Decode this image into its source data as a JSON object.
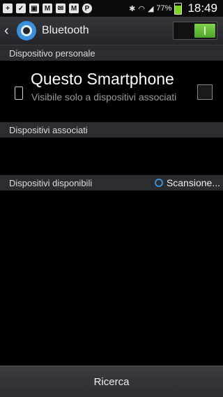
{
  "statusbar": {
    "left_icons": [
      "plus-icon",
      "check-icon",
      "image-icon",
      "gmail-icon",
      "email-icon",
      "gmail-icon",
      "parking-icon"
    ],
    "right_icons": [
      "bluetooth-icon",
      "wifi-icon",
      "signal-icon"
    ],
    "battery": "77%",
    "battery_level": 0.77,
    "time": "18:49"
  },
  "titlebar": {
    "title": "Bluetooth",
    "toggle_state": "on"
  },
  "sections": {
    "personal": "Dispositivo personale",
    "paired": "Dispositivi associati",
    "available": "Dispositivi disponibili"
  },
  "device": {
    "name": "Questo Smartphone",
    "subtitle": "Visibile solo a dispositivi associati"
  },
  "scan": {
    "label": "Scansione..."
  },
  "bottom": {
    "search_label": "Ricerca"
  },
  "colors": {
    "accent": "#3a8fd8",
    "toggle_on": "#6cc33c"
  }
}
